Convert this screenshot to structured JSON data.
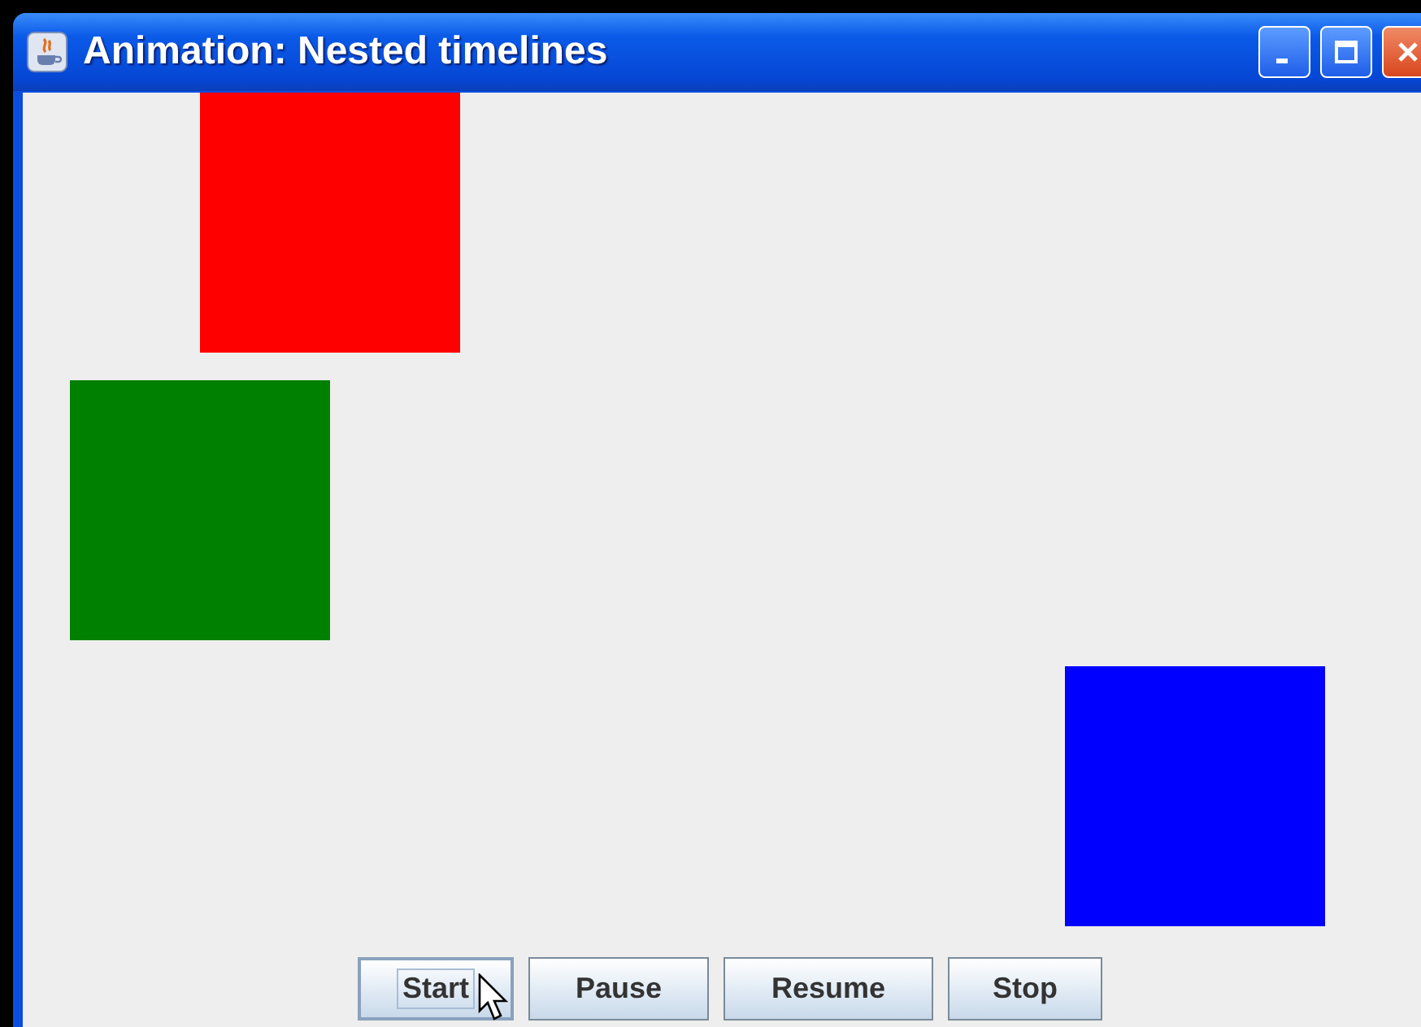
{
  "window": {
    "title": "Animation: Nested timelines"
  },
  "squares": [
    {
      "color": "#ff0000"
    },
    {
      "color": "#008000"
    },
    {
      "color": "#0000ff"
    }
  ],
  "buttons": [
    {
      "label": "Start",
      "focused": true
    },
    {
      "label": "Pause",
      "focused": false
    },
    {
      "label": "Resume",
      "focused": false
    },
    {
      "label": "Stop",
      "focused": false
    }
  ]
}
